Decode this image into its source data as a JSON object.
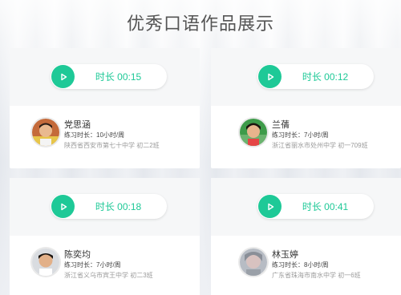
{
  "page": {
    "title": "优秀口语作品展示"
  },
  "colors": {
    "accent": "#1ec997",
    "card": "#ffffff"
  },
  "cards": [
    {
      "duration": "时长 00:15",
      "name": "党思涵",
      "practice": "练习时长：10小时/周",
      "school": "陕西省西安市第七十中学 初二2班",
      "avatar_icon": "student-avatar"
    },
    {
      "duration": "时长 00:12",
      "name": "兰蒨",
      "practice": "练习时长：7小时/周",
      "school": "浙江省丽水市处州中学 初一709班",
      "avatar_icon": "student-avatar"
    },
    {
      "duration": "时长 00:18",
      "name": "陈奕均",
      "practice": "练习时长：7小时/周",
      "school": "浙江省义乌市宾王中学 初二3班",
      "avatar_icon": "student-avatar"
    },
    {
      "duration": "时长 00:41",
      "name": "林玉婷",
      "practice": "练习时长：8小时/周",
      "school": "广东省珠海市南水中学 初一6班",
      "avatar_icon": "student-avatar"
    }
  ]
}
